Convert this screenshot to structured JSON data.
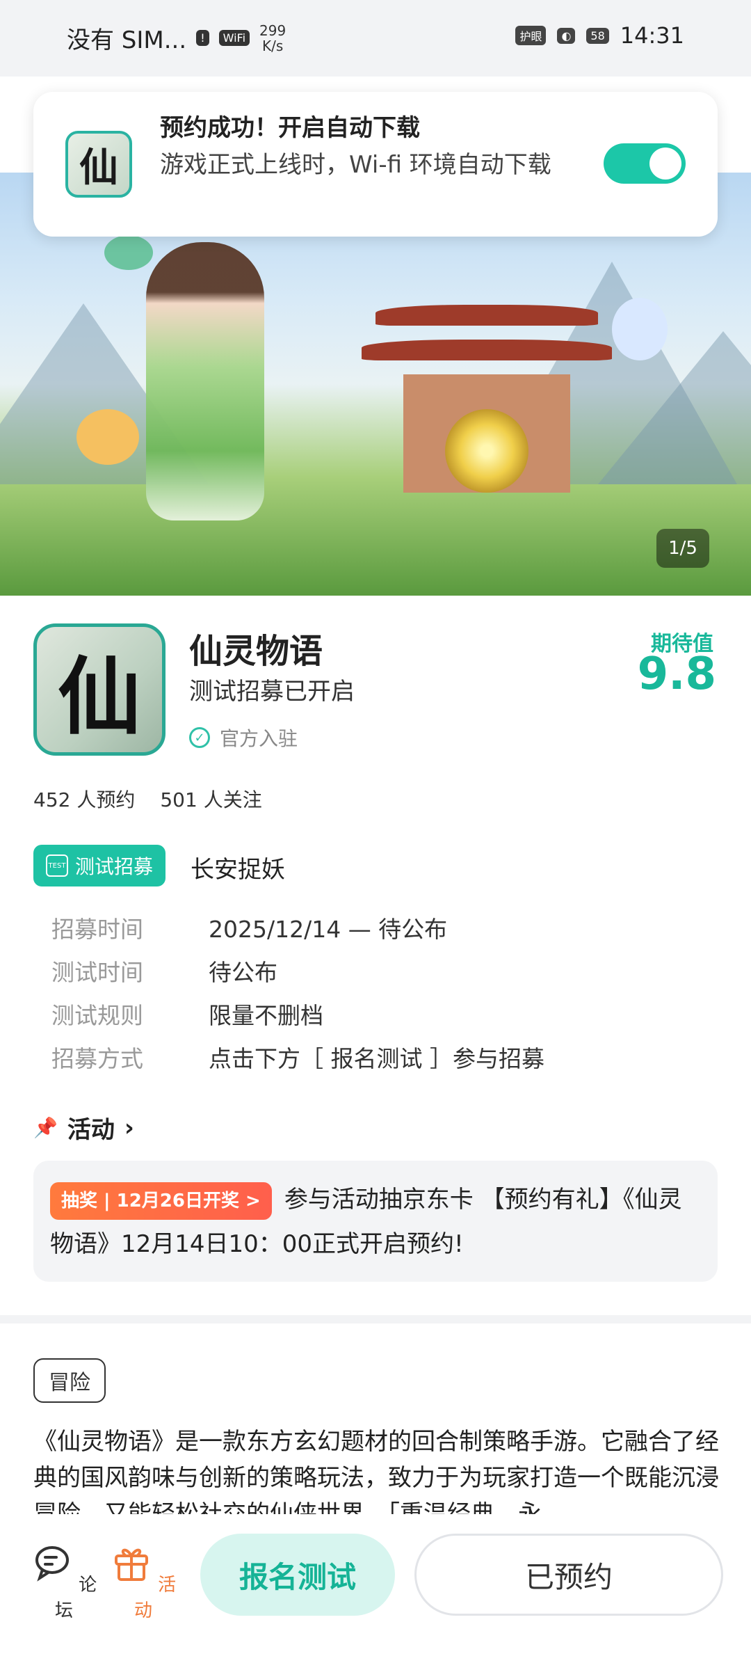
{
  "status_bar": {
    "carrier": "没有 SIM...",
    "speed_value": "299",
    "speed_unit": "K/s",
    "wifi_label": "WiFi",
    "eye_label": "护眼",
    "battery": "58",
    "time": "14:31"
  },
  "toast": {
    "title": "预约成功！开启自动下载",
    "description": "游戏正式上线时，Wi-fi 环境自动下载",
    "icon_char": "仙",
    "toggle_on": true
  },
  "banner": {
    "counter": "1/5"
  },
  "app": {
    "icon_char": "仙",
    "name": "仙灵物语",
    "status": "测试招募已开启",
    "verified_label": "官方入驻",
    "expect_label": "期待值",
    "expect_value": "9.8"
  },
  "stats": {
    "reservations": "452 人预约",
    "followers": "501 人关注"
  },
  "recruit": {
    "badge_label": "测试招募",
    "badge_icon_text": "TEST",
    "name": "长安捉妖",
    "rows": [
      {
        "key": "招募时间",
        "value": "2025/12/14 — 待公布"
      },
      {
        "key": "测试时间",
        "value": "待公布"
      },
      {
        "key": "测试规则",
        "value": "限量不删档"
      },
      {
        "key": "招募方式",
        "value": "点击下方［ 报名测试 ］参与招募"
      }
    ]
  },
  "activity": {
    "heading": "活动",
    "tag": "抽奖 | 12月26日开奖 >",
    "text": "参与活动抽京东卡 【预约有礼】《仙灵物语》12月14日10：00正式开启预约!"
  },
  "genre_tag": "冒险",
  "description": "《仙灵物语》是一款东方玄幻题材的回合制策略手游。它融合了经典的国风韵味与创新的策略玩法，致力于为玩家打造一个既能沉浸冒险，又能轻松社交的仙侠世界。「重温经典，永",
  "bottom_bar": {
    "forum_label": "论坛",
    "activity_label": "活动",
    "signup_button": "报名测试",
    "reserved_button": "已预约"
  },
  "colors": {
    "accent": "#1ec2a4",
    "lottery": "#ff6a45",
    "activity_icon": "#f07c3c"
  }
}
